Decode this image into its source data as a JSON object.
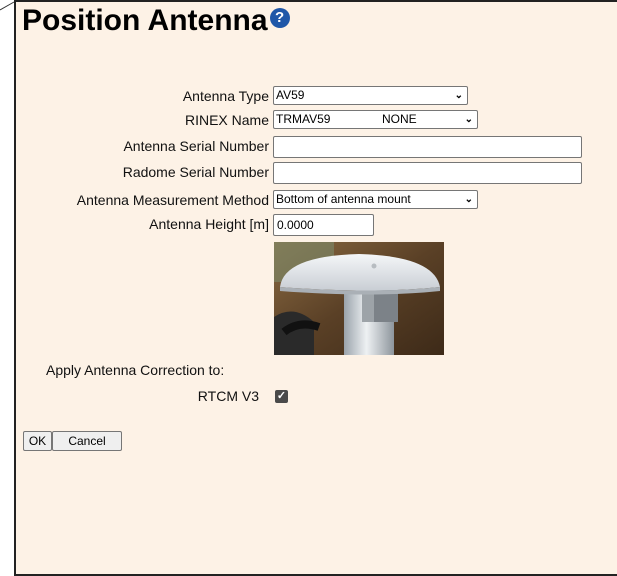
{
  "title": "Position Antenna",
  "help_icon": "question-circle-icon",
  "fields": {
    "antenna_type": {
      "label": "Antenna Type",
      "value": "AV59"
    },
    "rinex_name": {
      "label": "RINEX Name",
      "value": "TRMAV59",
      "value2": "NONE"
    },
    "antenna_serial": {
      "label": "Antenna Serial Number",
      "value": ""
    },
    "radome_serial": {
      "label": "Radome Serial Number",
      "value": ""
    },
    "measurement_method": {
      "label": "Antenna Measurement Method",
      "value": "Bottom of antenna mount"
    },
    "antenna_height": {
      "label": "Antenna Height [m]",
      "value": "0.0000"
    }
  },
  "apply_correction": {
    "label": "Apply Antenna Correction to:",
    "rtcm_v3": {
      "label": "RTCM V3",
      "checked": true
    }
  },
  "buttons": {
    "ok": "OK",
    "cancel": "Cancel"
  },
  "colors": {
    "panel_bg": "#fdf2e6",
    "help_icon": "#1f57a8"
  }
}
